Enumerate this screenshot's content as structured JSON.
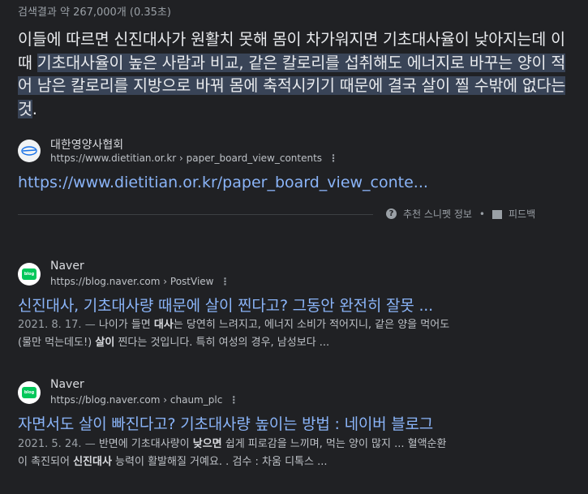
{
  "stats": "검색결과 약 267,000개 (0.35초)",
  "snippet": {
    "plain": "이들에 따르면 신진대사가 원활치 못해 몸이 차가워지면 기초대사율이 낮아지는데 이때 ",
    "highlight": "기초대사율이 높은 사람과 비교, 같은 칼로리를 섭취해도 에너지로 바꾸는 양이 적어 남은 칼로리를 지방으로 바꿔 몸에 축적시키기 때문에 결국 살이 찔 수밖에 없다는 것",
    "end": "."
  },
  "featured": {
    "site_name": "대한영양사협회",
    "url": "https://www.dietitian.or.kr › paper_board_view_contents",
    "link": "https://www.dietitian.or.kr/paper_board_view_conte...",
    "more": "⋮"
  },
  "about": {
    "label": "추천 스니펫 정보",
    "separator": "•",
    "feedback": "피드백",
    "info_icon": "?"
  },
  "results": [
    {
      "site_name": "Naver",
      "url": "https://blog.naver.com › PostView",
      "favicon_text": "blog",
      "title": "신진대사, 기초대사량 때문에 살이 찐다고? 그동안 완전히 잘못 ...",
      "date": "2021. 8. 17. — ",
      "desc_1a": "나이가 들면 ",
      "desc_1b": "대사",
      "desc_1c": "는 당연히 느려지고, 에너지 소비가 적어지니, 같은 양을 먹어도",
      "desc_2a": "(물만 먹는데도!) ",
      "desc_2b": "살이",
      "desc_2c": " 찐다는 것입니다. 특히 여성의 경우, 남성보다 ..."
    },
    {
      "site_name": "Naver",
      "url": "https://blog.naver.com › chaum_plc",
      "favicon_text": "blog",
      "title": "자면서도 살이 빠진다고? 기초대사량 높이는 방법 : 네이버 블로그",
      "date": "2021. 5. 24. — ",
      "desc_1a": "반면에 기초대사량이 ",
      "desc_1b": "낮으면",
      "desc_1c": " 쉽게 피로감을 느끼며, 먹는 양이 많지 ... 혈액순환",
      "desc_2a": "이 촉진되어 ",
      "desc_2b": "신진대사",
      "desc_2c": " 능력이 활발해질 거예요. . 검수 : 차움 디톡스 ..."
    }
  ],
  "icons": {
    "featured_favicon": "dietitian-logo-icon",
    "naver_favicon": "naver-blog-icon",
    "more": "more-vert-icon",
    "info": "help-circle-icon",
    "feedback": "feedback-icon"
  }
}
